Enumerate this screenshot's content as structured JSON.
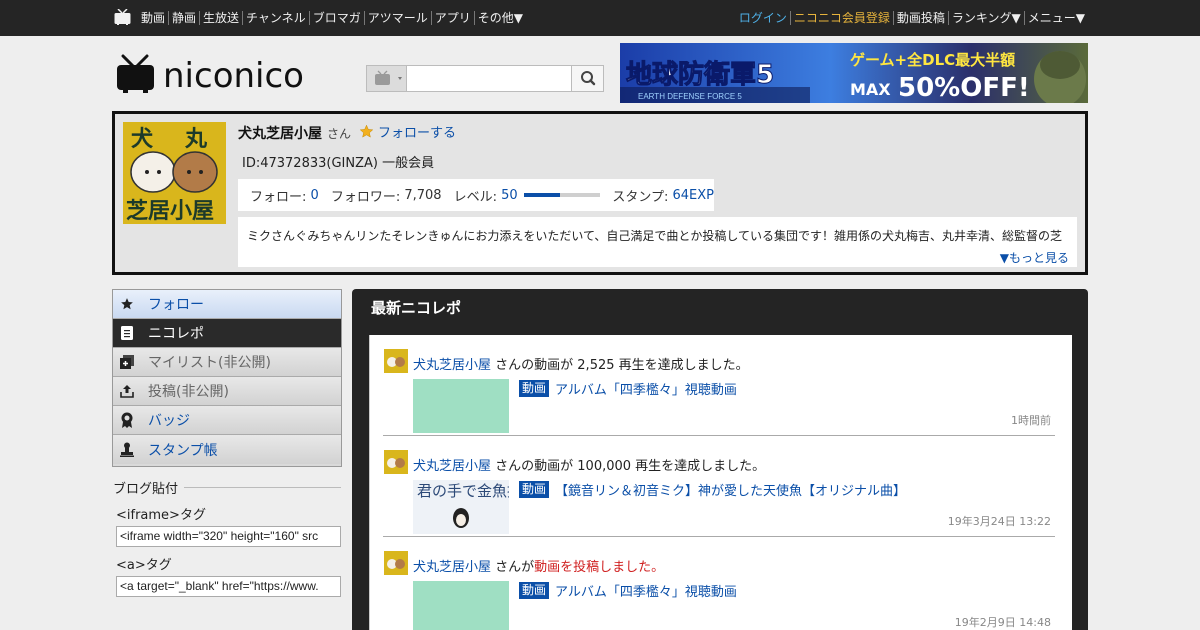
{
  "nav": {
    "left": [
      "動画",
      "静画",
      "生放送",
      "チャンネル",
      "ブロマガ",
      "アツマール",
      "アプリ",
      "その他▼"
    ],
    "login": "ログイン",
    "premium": "ニコニコ会員登録",
    "right": [
      "動画投稿",
      "ランキング▼",
      "メニュー▼"
    ]
  },
  "header": {
    "logo_text": "niconico",
    "search_placeholder": "",
    "banner": {
      "title": "地球防衛軍5",
      "sub": "EARTH DEFENSE FORCE 5",
      "promo1": "ゲーム+全DLC最大半額",
      "promo2": "MAX",
      "promo3": "50%OFF!"
    }
  },
  "profile": {
    "name": "犬丸芝居小屋",
    "honorific": "さん",
    "follow_label": "フォローする",
    "id_line": "ID:47372833(GINZA) 一般会員",
    "stats": {
      "follow_label": "フォロー:",
      "follow_value": "0",
      "follower_label": "フォロワー:",
      "follower_value": "7,708",
      "level_label": "レベル:",
      "level_value": "50",
      "level_progress": 0.47,
      "stamp_label": "スタンプ:",
      "stamp_value": "64EXP"
    },
    "description": "ミクさんぐみちゃんリンたそレンきゅんにお力添えをいただいて、自己満足で曲とか投稿している集団です！雑用係の犬丸梅吉、丸井幸清、総監督の芝",
    "more": "▼もっと見る",
    "avatar_text": [
      "犬",
      "丸",
      "芝居小屋"
    ]
  },
  "sidemenu": [
    {
      "label": "フォロー",
      "icon": "star-icon"
    },
    {
      "label": "ニコレポ",
      "icon": "document-icon"
    },
    {
      "label": "マイリスト(非公開)",
      "icon": "mylist-icon"
    },
    {
      "label": "投稿(非公開)",
      "icon": "upload-icon"
    },
    {
      "label": "バッジ",
      "icon": "badge-icon"
    },
    {
      "label": "スタンプ帳",
      "icon": "stamp-icon"
    }
  ],
  "blog": {
    "title": "ブログ貼付",
    "iframe_label": "<iframe>タグ",
    "iframe_value": "<iframe width=\"320\" height=\"160\" src",
    "a_label": "<a>タグ",
    "a_value": "<a target=\"_blank\" href=\"https://www."
  },
  "report": {
    "title": "最新ニコレポ",
    "entries": [
      {
        "user": "犬丸芝居小屋",
        "text": "さんの動画が 2,525 再生を達成しました。",
        "red_text": "",
        "category": "動画",
        "title": "アルバム「四季檻々」視聴動画",
        "time": "1時間前"
      },
      {
        "user": "犬丸芝居小屋",
        "text": "さんの動画が 100,000 再生を達成しました。",
        "red_text": "",
        "category": "動画",
        "title": "【鏡音リン＆初音ミク】神が愛した天使魚【オリジナル曲】",
        "time": "19年3月24日 13:22",
        "thumb_text": "君の手で金魚掬え"
      },
      {
        "user": "犬丸芝居小屋",
        "text": "さんが",
        "red_text": "動画を投稿しました。",
        "category": "動画",
        "title": "アルバム「四季檻々」視聴動画",
        "time": "19年2月9日 14:48"
      }
    ]
  }
}
